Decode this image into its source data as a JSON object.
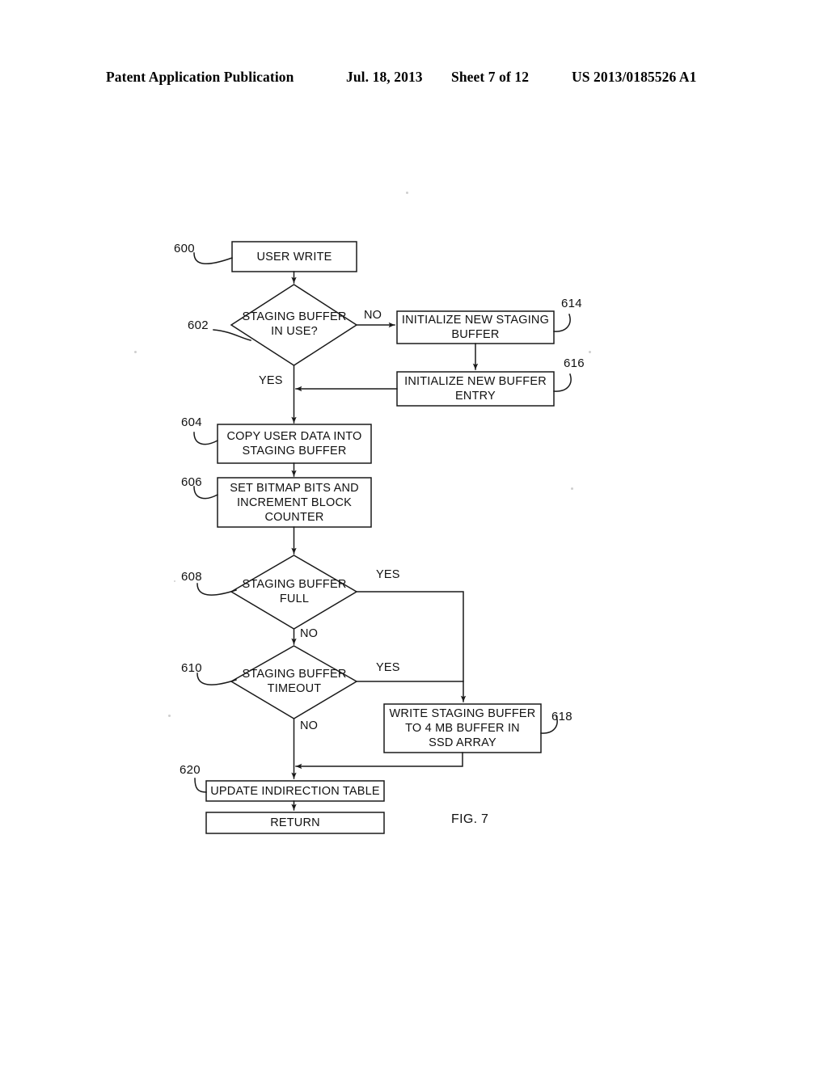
{
  "header": {
    "publication": "Patent Application Publication",
    "date": "Jul. 18, 2013",
    "sheet": "Sheet 7 of 12",
    "patent_number": "US 2013/0185526 A1"
  },
  "figure": {
    "caption": "FIG. 7",
    "line_color": "#1a1a1a",
    "background": "#ffffff"
  },
  "nodes": {
    "n600": {
      "ref": "600",
      "text": "USER WRITE",
      "shape": "rect"
    },
    "n602": {
      "ref": "602",
      "text": "STAGING BUFFER\nIN USE?",
      "shape": "diamond"
    },
    "n614": {
      "ref": "614",
      "text": "INITIALIZE NEW STAGING\nBUFFER",
      "shape": "rect"
    },
    "n616": {
      "ref": "616",
      "text": "INITIALIZE NEW BUFFER\nENTRY",
      "shape": "rect"
    },
    "n604": {
      "ref": "604",
      "text": "COPY USER DATA INTO\nSTAGING BUFFER",
      "shape": "rect"
    },
    "n606": {
      "ref": "606",
      "text": "SET BITMAP BITS AND\nINCREMENT BLOCK\nCOUNTER",
      "shape": "rect"
    },
    "n608": {
      "ref": "608",
      "text": "STAGING BUFFER\nFULL",
      "shape": "diamond"
    },
    "n610": {
      "ref": "610",
      "text": "STAGING BUFFER\nTIMEOUT",
      "shape": "diamond"
    },
    "n618": {
      "ref": "618",
      "text": "WRITE STAGING BUFFER\nTO 4 MB BUFFER IN\nSSD ARRAY",
      "shape": "rect"
    },
    "n620": {
      "ref": "620",
      "text": "UPDATE INDIRECTION TABLE",
      "shape": "rect"
    },
    "n_return": {
      "text": "RETURN",
      "shape": "rect"
    }
  },
  "edge_labels": {
    "e602_no": "NO",
    "e602_yes": "YES",
    "e608_yes": "YES",
    "e608_no": "NO",
    "e610_yes": "YES",
    "e610_no": "NO"
  }
}
